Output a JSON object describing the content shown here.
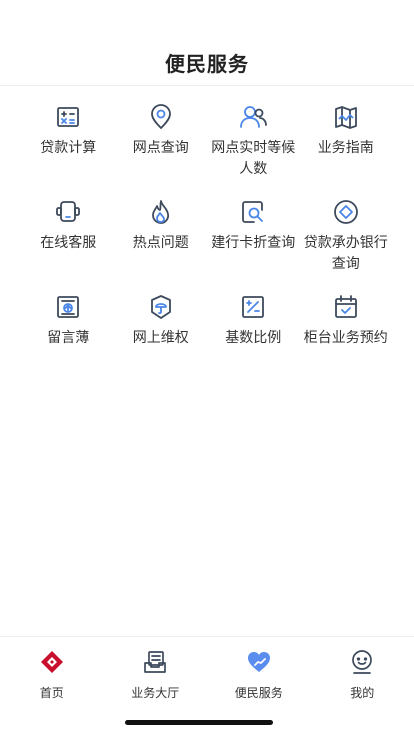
{
  "header": {
    "title": "便民服务"
  },
  "grid": {
    "items": [
      {
        "label": "贷款计算",
        "icon": "calculator-icon"
      },
      {
        "label": "网点查询",
        "icon": "location-pin-icon"
      },
      {
        "label": "网点实时等候人数",
        "icon": "users-icon"
      },
      {
        "label": "业务指南",
        "icon": "map-icon"
      },
      {
        "label": "在线客服",
        "icon": "headset-icon"
      },
      {
        "label": "热点问题",
        "icon": "flame-icon"
      },
      {
        "label": "建行卡折查询",
        "icon": "card-search-icon"
      },
      {
        "label": "贷款承办银行查询",
        "icon": "diamond-circle-icon"
      },
      {
        "label": "留言薄",
        "icon": "message-board-icon"
      },
      {
        "label": "网上维权",
        "icon": "shield-umbrella-icon"
      },
      {
        "label": "基数比例",
        "icon": "percent-icon"
      },
      {
        "label": "柜台业务预约",
        "icon": "calendar-check-icon"
      }
    ]
  },
  "tabbar": {
    "items": [
      {
        "label": "首页",
        "icon": "home-logo-icon"
      },
      {
        "label": "业务大厅",
        "icon": "business-hall-icon"
      },
      {
        "label": "便民服务",
        "icon": "heart-hand-icon"
      },
      {
        "label": "我的",
        "icon": "smile-face-icon"
      }
    ]
  },
  "colors": {
    "icon_stroke": "#3d4a5c",
    "icon_accent": "#4a86e8",
    "brand_red": "#c8102e",
    "tab_active": "#5b8def"
  }
}
